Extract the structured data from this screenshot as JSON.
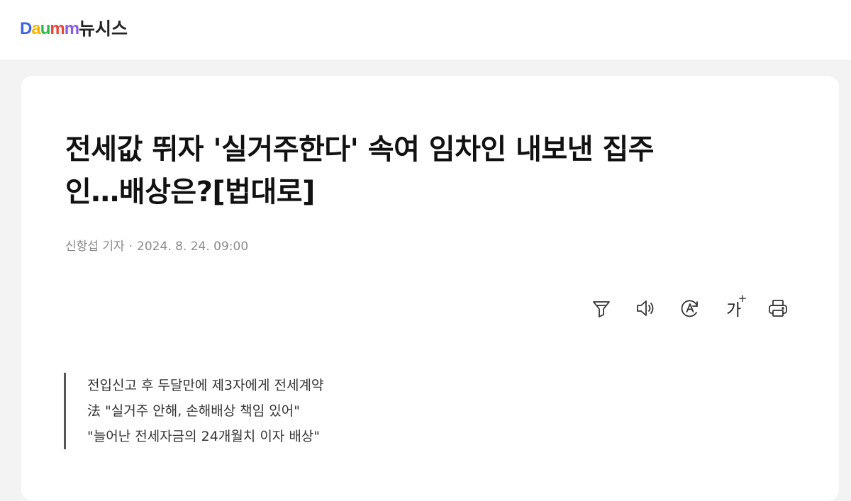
{
  "header": {
    "logo_parts": [
      "D",
      "a",
      "u",
      "m",
      "m"
    ],
    "site_name": "뉴시스"
  },
  "article": {
    "title_line1": "전세값 뛰자 '실거주한다' 속여 임차인 내보낸 집주",
    "title_line2": "인…배상은?[법대로]",
    "author": "신항섭 기자",
    "separator": "·",
    "datetime": "2024. 8. 24. 09:00",
    "summary": [
      "전입신고 후 두달만에 제3자에게 전세계약",
      "法 \"실거주 안해, 손해배상 책임 있어\"",
      "\"늘어난 전세자금의 24개월치 이자 배상\""
    ]
  },
  "toolbar": {
    "icons": [
      "filter-icon",
      "speaker-icon",
      "translate-icon",
      "font-size-icon",
      "print-icon"
    ],
    "font_label": "가",
    "font_plus": "+"
  }
}
